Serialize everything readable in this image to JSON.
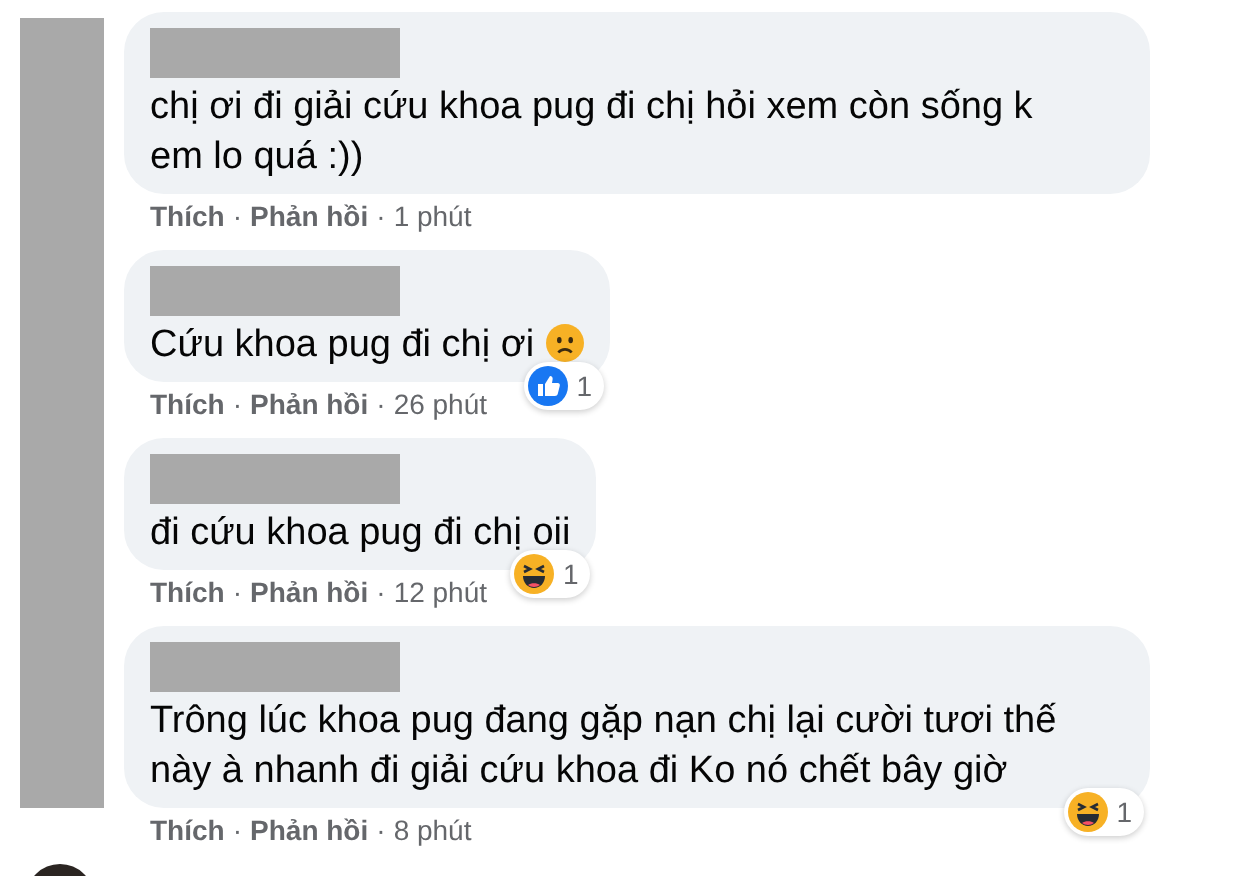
{
  "separator": "·",
  "comments": [
    {
      "text": "chị ơi đi giải cứu khoa pug đi chị hỏi xem còn sống k em lo quá :))",
      "sad_emoji": false,
      "wide": true,
      "actions": [
        "Thích",
        "Phản hồi"
      ],
      "time": "1 phút"
    },
    {
      "text": "Cứu khoa pug đi chị ơi",
      "sad_emoji": true,
      "wide": false,
      "actions": [
        "Thích",
        "Phản hồi"
      ],
      "time": "26 phút",
      "reaction": {
        "kind": "like",
        "count": "1"
      }
    },
    {
      "text": "đi cứu khoa pug đi chị oii",
      "sad_emoji": false,
      "wide": false,
      "actions": [
        "Thích",
        "Phản hồi"
      ],
      "time": "12 phút",
      "reaction": {
        "kind": "haha",
        "count": "1"
      }
    },
    {
      "text": "Trông lúc khoa pug đang gặp nạn chị lại cười tươi thế này à nhanh đi giải cứu khoa đi Ko nó chết bây giờ",
      "sad_emoji": false,
      "wide": true,
      "actions": [
        "Thích",
        "Phản hồi"
      ],
      "time": "8 phút",
      "reaction": {
        "kind": "haha",
        "count": "1"
      }
    }
  ]
}
